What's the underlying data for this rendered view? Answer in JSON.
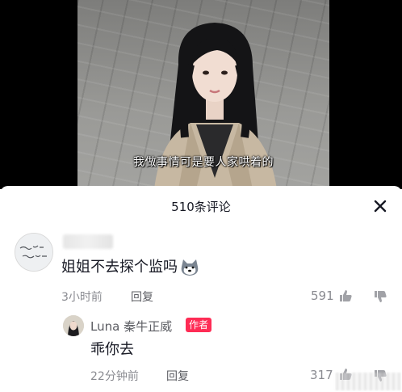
{
  "video": {
    "subtitle": "我做事情可是要人家哄着的"
  },
  "comments_panel": {
    "title": "510条评论",
    "close_icon": "close-icon"
  },
  "comments": [
    {
      "username": "",
      "text": "姐姐不去探个监吗",
      "emoji": "husky-dog-emoji",
      "time": "3小时前",
      "reply_label": "回复",
      "likes": "591",
      "replies": [
        {
          "username": "Luna 秦牛正威",
          "badge": "作者",
          "text": "乖你去",
          "time": "22分钟前",
          "reply_label": "回复",
          "likes": "317"
        }
      ]
    }
  ],
  "colors": {
    "author_badge": "#fe2c55",
    "meta_text": "#8a8b91",
    "primary_text": "#161823"
  }
}
